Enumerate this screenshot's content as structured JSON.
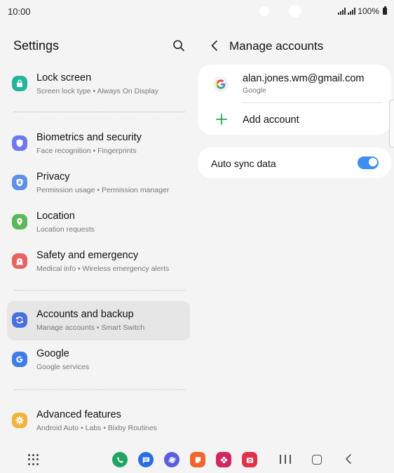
{
  "status": {
    "time": "10:00",
    "battery": "100%"
  },
  "settings": {
    "title": "Settings",
    "items": [
      {
        "title": "Lock screen",
        "subtitle": "Screen lock type  •  Always On Display",
        "icon": "lock-icon",
        "color": "#26b39c"
      },
      {
        "title": "Biometrics and security",
        "subtitle": "Face recognition  •  Fingerprints",
        "icon": "shield-icon",
        "color": "#6e79f0"
      },
      {
        "title": "Privacy",
        "subtitle": "Permission usage  •  Permission manager",
        "icon": "privacy-shield-icon",
        "color": "#5f8fe6"
      },
      {
        "title": "Location",
        "subtitle": "Location requests",
        "icon": "location-pin-icon",
        "color": "#5cb85c"
      },
      {
        "title": "Safety and emergency",
        "subtitle": "Medical info  •  Wireless emergency alerts",
        "icon": "emergency-icon",
        "color": "#e86262"
      },
      {
        "title": "Accounts and backup",
        "subtitle": "Manage accounts  •  Smart Switch",
        "icon": "sync-icon",
        "color": "#4a6fdd"
      },
      {
        "title": "Google",
        "subtitle": "Google services",
        "icon": "google-g-icon",
        "color": "#3f7ce8"
      },
      {
        "title": "Advanced features",
        "subtitle": "Android Auto  •  Labs  •  Bixby Routines",
        "icon": "advanced-gear-icon",
        "color": "#f1b33a"
      }
    ]
  },
  "manage": {
    "title": "Manage accounts",
    "account": {
      "email": "alan.jones.wm@gmail.com",
      "type": "Google"
    },
    "add_label": "Add account",
    "sync_label": "Auto sync data",
    "sync_enabled": true
  },
  "dock": [
    {
      "name": "phone-app-icon",
      "color": "#1fa463"
    },
    {
      "name": "messages-app-icon",
      "color": "#2a6ee0"
    },
    {
      "name": "internet-app-icon",
      "color": "#5a5fd8"
    },
    {
      "name": "notes-app-icon",
      "color": "#f0662e"
    },
    {
      "name": "gallery-app-icon",
      "color": "#d3265f"
    },
    {
      "name": "camera-app-icon",
      "color": "#e0304a"
    }
  ]
}
